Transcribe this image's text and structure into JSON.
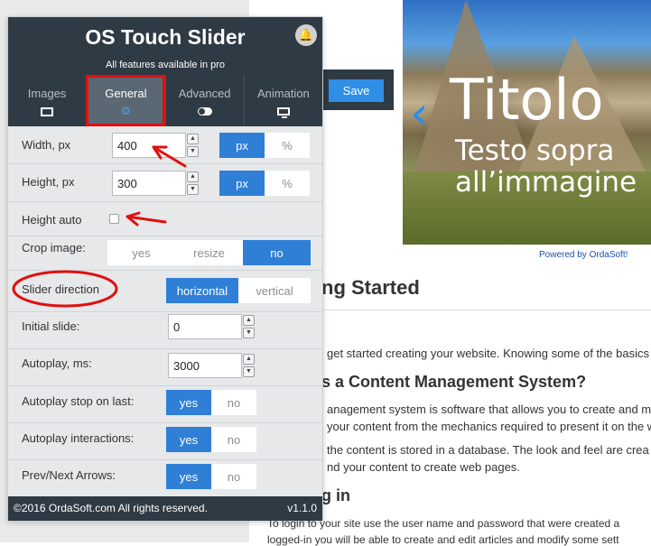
{
  "background_page": {
    "save_button": "Save",
    "slide_title": "Titolo",
    "slide_subtitle_line1": "Testo sopra",
    "slide_subtitle_line2": "all’immagine",
    "powered_by": "Powered by OrdaSoft!",
    "heading_started": "ng Started",
    "intro_text": "get started creating your website. Knowing some of the basics",
    "heading_cms": "s a Content Management System?",
    "cms_p1_line1": "anagement system is software that allows you to create and m",
    "cms_p1_line2": "your content from the mechanics required to present it on the w",
    "cms_p2_line1": "the content is stored in a database. The look and feel are crea",
    "cms_p2_line2": "nd your content to create web pages.",
    "heading_login": "g in",
    "login_line1": "To login to your site use the user name and password that were created a",
    "login_line2": "logged-in you will be able to create and edit articles and modify some sett"
  },
  "panel": {
    "title": "OS Touch Slider",
    "pro_note": "All features available in pro",
    "tabs": [
      {
        "label": "Images",
        "icon": "image-icon"
      },
      {
        "label": "General",
        "icon": "gears-icon"
      },
      {
        "label": "Advanced",
        "icon": "toggle-icon"
      },
      {
        "label": "Animation",
        "icon": "monitor-icon"
      }
    ],
    "active_tab": "General",
    "fields": {
      "width": {
        "label": "Width, px",
        "value": "400",
        "units": [
          "px",
          "%"
        ],
        "selected": "px"
      },
      "height": {
        "label": "Height, px",
        "value": "300",
        "units": [
          "px",
          "%"
        ],
        "selected": "px"
      },
      "height_auto": {
        "label": "Height auto",
        "checked": false
      },
      "crop": {
        "label": "Crop image:",
        "options": [
          "yes",
          "resize",
          "no"
        ],
        "selected": "no"
      },
      "direction": {
        "label": "Slider direction",
        "options": [
          "horizontal",
          "vertical"
        ],
        "selected": "horizontal"
      },
      "initial_slide": {
        "label": "Initial slide:",
        "value": "0"
      },
      "autoplay": {
        "label": "Autoplay, ms:",
        "value": "3000"
      },
      "autoplay_stop": {
        "label": "Autoplay stop on last:",
        "options": [
          "yes",
          "no"
        ],
        "selected": "yes"
      },
      "autoplay_interactions": {
        "label": "Autoplay interactions:",
        "options": [
          "yes",
          "no"
        ],
        "selected": "yes"
      },
      "arrows": {
        "label": "Prev/Next Arrows:",
        "options": [
          "yes",
          "no"
        ],
        "selected": "yes"
      }
    },
    "footer_copyright": "©2016 OrdaSoft.com All rights reserved.",
    "footer_version": "v1.1.0"
  },
  "colors": {
    "panel_dark": "#2e3a44",
    "accent_blue": "#2f7fd6",
    "annotation_red": "#e01010"
  }
}
